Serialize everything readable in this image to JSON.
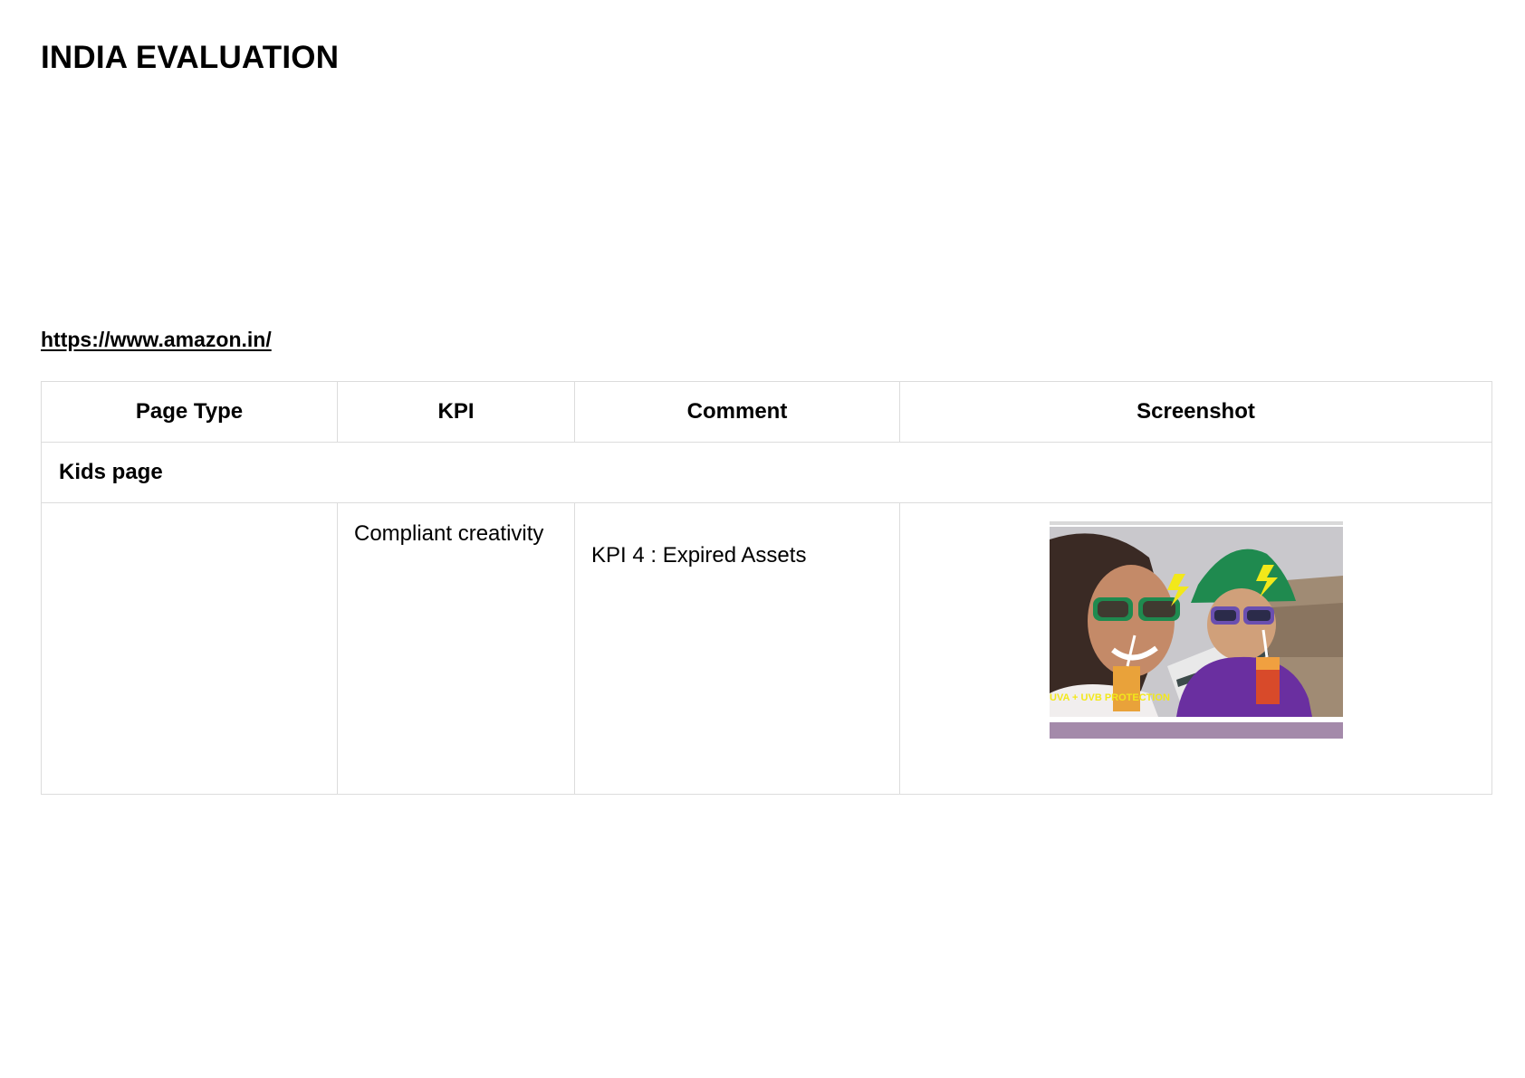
{
  "header": {
    "title": "INDIA EVALUATION"
  },
  "site": {
    "url_text": "https://www.amazon.in/"
  },
  "table": {
    "columns": [
      "Page Type",
      "KPI",
      "Comment",
      "Screenshot"
    ],
    "sections": [
      {
        "label": "Kids page",
        "rows": [
          {
            "page_type": "",
            "kpi": "Compliant creativity",
            "comment": "KPI 4 : Expired Assets",
            "screenshot": {
              "description_icon": "kids-sunglasses-banner-image",
              "overlay_text": "UVA + UVB PROTECTION",
              "colors": {
                "sky": "#c7c6c9",
                "purple_strip": "#a48aaa",
                "green_hat": "#1f8a4f",
                "purple_shirt": "#6a2fa0",
                "yellow_text": "#f2e81a"
              }
            }
          }
        ]
      }
    ]
  }
}
